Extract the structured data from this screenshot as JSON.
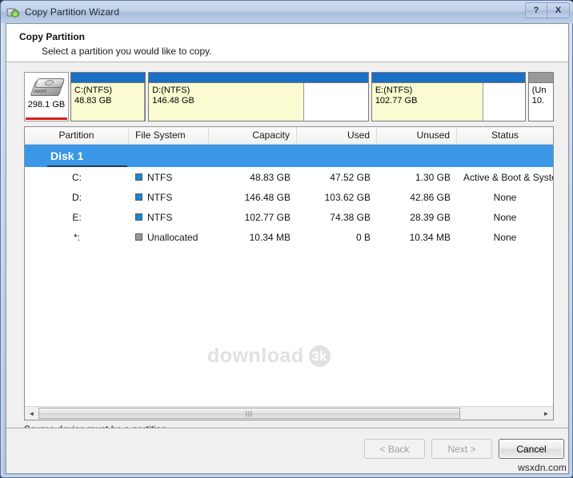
{
  "window": {
    "title": "Copy Partition Wizard",
    "icon": "app-partition-icon",
    "help_label": "?",
    "close_label": "X"
  },
  "header": {
    "title": "Copy Partition",
    "subtitle": "Select a partition you would like to copy."
  },
  "disk_map": {
    "disk_icon": "hard-disk-icon",
    "disk_capacity": "298.1 GB",
    "partitions": [
      {
        "label": "C:(NTFS)",
        "size": "48.83 GB",
        "kind": "ntfs",
        "width_pct": 16.4,
        "used_pct": 100
      },
      {
        "label": "D:(NTFS)",
        "size": "146.48 GB",
        "kind": "ntfs",
        "width_pct": 48.0,
        "used_pct": 71
      },
      {
        "label": "E:(NTFS)",
        "size": "102.77 GB",
        "kind": "ntfs",
        "width_pct": 33.6,
        "used_pct": 73
      },
      {
        "label": "(Un",
        "size": "10.",
        "kind": "unalloc",
        "width_pct": 5.6,
        "used_pct": 0
      }
    ]
  },
  "table": {
    "columns": [
      "Partition",
      "File System",
      "Capacity",
      "Used",
      "Unused",
      "Status"
    ],
    "disk_group": "Disk 1",
    "rows": [
      {
        "partition": "C:",
        "file_system": "NTFS",
        "fs_kind": "ntfs",
        "capacity": "48.83 GB",
        "used": "47.52 GB",
        "unused": "1.30 GB",
        "status": "Active & Boot & Syste"
      },
      {
        "partition": "D:",
        "file_system": "NTFS",
        "fs_kind": "ntfs",
        "capacity": "146.48 GB",
        "used": "103.62 GB",
        "unused": "42.86 GB",
        "status": "None"
      },
      {
        "partition": "E:",
        "file_system": "NTFS",
        "fs_kind": "ntfs",
        "capacity": "102.77 GB",
        "used": "74.38 GB",
        "unused": "28.39 GB",
        "status": "None"
      },
      {
        "partition": "*:",
        "file_system": "Unallocated",
        "fs_kind": "unalloc",
        "capacity": "10.34 MB",
        "used": "0 B",
        "unused": "10.34 MB",
        "status": "None"
      }
    ]
  },
  "watermark": {
    "text": "download",
    "badge": "3k"
  },
  "scrollbar": {
    "left_arrow": "◄",
    "right_arrow": "►",
    "grip": "|||"
  },
  "status_message": "Source device must be a partition.",
  "buttons": {
    "back": "< Back",
    "next": "Next >",
    "cancel": "Cancel"
  },
  "site_watermark": "wsxdn.com",
  "colors": {
    "accent_blue": "#1a6fc4",
    "selection_blue": "#3b97e8",
    "partition_yellow": "#fbfbd2",
    "unalloc_gray": "#9a9a9a",
    "disk_red": "#d41f1f"
  }
}
